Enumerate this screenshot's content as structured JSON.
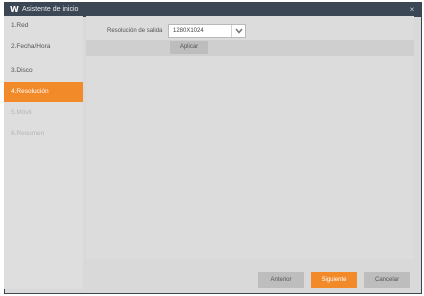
{
  "window": {
    "title": "Asistente de inicio",
    "logo": "W",
    "close_icon": "×"
  },
  "sidebar": {
    "items": [
      {
        "label": "1.Red",
        "state": "normal"
      },
      {
        "label": "2.Fecha/Hora",
        "state": "normal"
      },
      {
        "label": "3.Disco",
        "state": "normal"
      },
      {
        "label": "4.Resolución",
        "state": "active"
      },
      {
        "label": "5.Móvil",
        "state": "disabled"
      },
      {
        "label": "6.Resumen",
        "state": "disabled"
      }
    ]
  },
  "resolution": {
    "label": "Resolución de salida",
    "selected": "1280X1024",
    "apply_label": "Aplicar"
  },
  "footer": {
    "previous_label": "Anterior",
    "next_label": "Siguiente",
    "cancel_label": "Cancelar"
  },
  "colors": {
    "accent": "#f28a2a",
    "titlebar": "#3b4754"
  }
}
